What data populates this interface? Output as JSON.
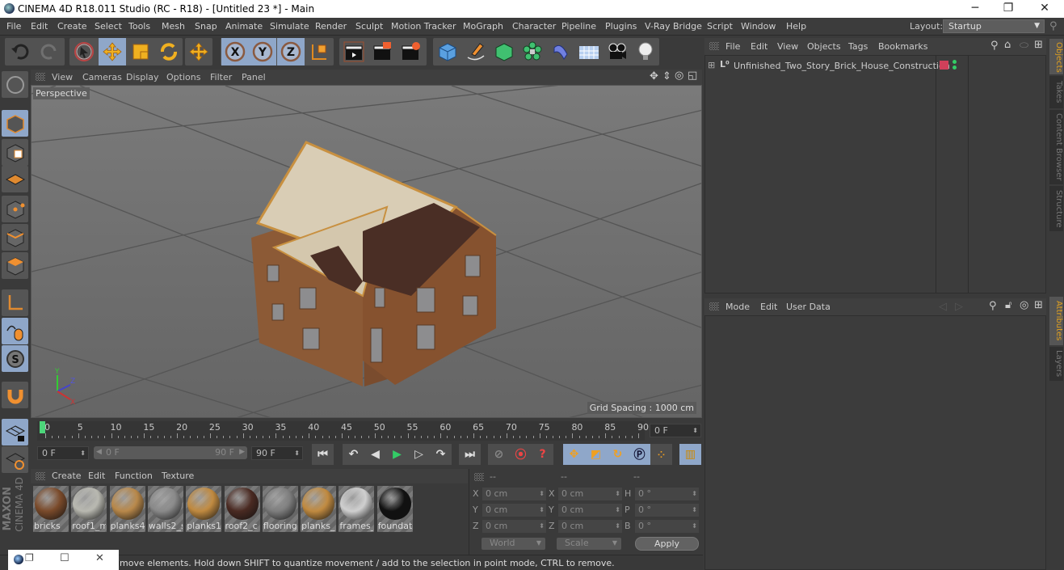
{
  "window": {
    "title": "CINEMA 4D R18.011 Studio (RC - R18) - [Untitled 23 *] - Main",
    "minimize_glyph": "─",
    "restore_glyph": "❐",
    "close_glyph": "✕"
  },
  "menubar": {
    "items": [
      "File",
      "Edit",
      "Create",
      "Select",
      "Tools",
      "Mesh",
      "Snap",
      "Animate",
      "Simulate",
      "Render",
      "Sculpt",
      "Motion Tracker",
      "MoGraph",
      "Character",
      "Pipeline",
      "Plugins",
      "V-Ray Bridge",
      "Script",
      "Window",
      "Help"
    ],
    "layout_label": "Layout:",
    "layout_value": "Startup"
  },
  "toolbar": {
    "axis_x": "X",
    "axis_y": "Y",
    "axis_z": "Z",
    "icons": [
      "undo-icon",
      "redo-icon",
      "live-selection-icon",
      "move-icon",
      "scale-icon",
      "rotate-icon",
      "last-tool-icon",
      "x-axis-lock-icon",
      "y-axis-lock-icon",
      "z-axis-lock-icon",
      "coordinate-system-icon",
      "render-view-icon",
      "render-to-picture-viewer-icon",
      "render-settings-icon",
      "cube-icon",
      "pen-icon",
      "subdivision-icon",
      "cloner-icon",
      "deformer-icon",
      "floor-icon",
      "camera-icon",
      "light-icon"
    ]
  },
  "viewport": {
    "menu": [
      "View",
      "Cameras",
      "Display",
      "Options",
      "Filter",
      "Panel"
    ],
    "camera_label": "Perspective",
    "grid_spacing": "Grid Spacing : 1000 cm",
    "axis_x": "X",
    "axis_y": "Y",
    "axis_z": "Z"
  },
  "timeline": {
    "ticks": [
      "0",
      "5",
      "10",
      "15",
      "20",
      "25",
      "30",
      "35",
      "40",
      "45",
      "50",
      "55",
      "60",
      "65",
      "70",
      "75",
      "80",
      "85",
      "90"
    ],
    "current_frame": "0 F",
    "start_field": "0 F",
    "range_start": "0 F",
    "range_end": "90 F",
    "end_field": "90 F",
    "playhead_frame": 0,
    "max_frame": 90
  },
  "materials": {
    "menu": [
      "Create",
      "Edit",
      "Function",
      "Texture"
    ],
    "items": [
      {
        "name": "bricks",
        "color": "#7a4a2a"
      },
      {
        "name": "roof1_m",
        "color": "#b8b8b0"
      },
      {
        "name": "planks4",
        "color": "#b8884a"
      },
      {
        "name": "walls2_s",
        "color": "#8a8a8a"
      },
      {
        "name": "planks1",
        "color": "#c08a40"
      },
      {
        "name": "roof2_c",
        "color": "#4a2a22"
      },
      {
        "name": "flooring",
        "color": "#7e7e7e"
      },
      {
        "name": "planks_",
        "color": "#c08a40"
      },
      {
        "name": "frames_",
        "color": "#cfcfcf"
      },
      {
        "name": "foundat",
        "color": "#111111"
      }
    ]
  },
  "coordinates": {
    "headers": [
      "--",
      "--",
      "--"
    ],
    "rows": [
      {
        "pos_label": "X",
        "pos": "0 cm",
        "size_label": "X",
        "size": "0 cm",
        "rot_label": "H",
        "rot": "0 °"
      },
      {
        "pos_label": "Y",
        "pos": "0 cm",
        "size_label": "Y",
        "size": "0 cm",
        "rot_label": "P",
        "rot": "0 °"
      },
      {
        "pos_label": "Z",
        "pos": "0 cm",
        "size_label": "Z",
        "size": "0 cm",
        "rot_label": "B",
        "rot": "0 °"
      }
    ],
    "mode_dropdown": "World",
    "size_dropdown": "Scale",
    "apply_label": "Apply"
  },
  "status": {
    "message": "move elements. Hold down SHIFT to quantize movement / add to the selection in point mode, CTRL to remove."
  },
  "objects_panel": {
    "menu": [
      "File",
      "Edit",
      "View",
      "Objects",
      "Tags",
      "Bookmarks"
    ],
    "objects": [
      {
        "name": "Unfinished_Two_Story_Brick_House_Construction",
        "layer_color": "#d0405a"
      }
    ]
  },
  "attributes_panel": {
    "menu": [
      "Mode",
      "Edit",
      "User Data"
    ]
  },
  "right_tabs": {
    "top": [
      "Objects",
      "Takes",
      "Content Browser",
      "Structure"
    ],
    "bottom": [
      "Attributes",
      "Layers"
    ]
  },
  "branding": {
    "maxon": "MAXON",
    "cinema": "CINEMA 4D"
  }
}
